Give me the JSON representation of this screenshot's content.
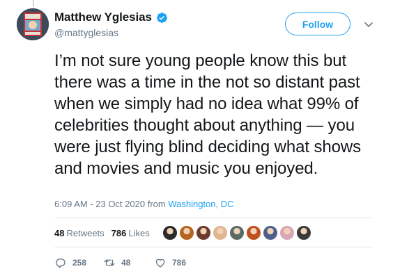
{
  "user": {
    "display_name": "Matthew Yglesias",
    "handle": "@mattyglesias",
    "verified": true,
    "avatar_icon": "profile-photo"
  },
  "follow_label": "Follow",
  "tweet": {
    "text": "I’m not sure young people know this but there was a time in the not so distant past when we simply had no idea what 99% of celebrities thought about anything — you were just flying blind deciding what shows and movies and music you enjoyed.",
    "time": "6:09 AM - 23 Oct 2020",
    "from_label": "from",
    "location": "Washington, DC"
  },
  "stats": {
    "retweets_count": "48",
    "retweets_label": "Retweets",
    "likes_count": "786",
    "likes_label": "Likes"
  },
  "likers": [
    {
      "icon": "liker-avatar",
      "color": "#2b2b2b"
    },
    {
      "icon": "liker-avatar",
      "color": "#b5651d"
    },
    {
      "icon": "liker-avatar",
      "color": "#6b3a2a"
    },
    {
      "icon": "liker-avatar",
      "color": "#e0b48f"
    },
    {
      "icon": "liker-avatar",
      "color": "#5a6b66"
    },
    {
      "icon": "liker-avatar",
      "color": "#c0501e"
    },
    {
      "icon": "liker-avatar",
      "color": "#4f5f8a"
    },
    {
      "icon": "liker-avatar",
      "color": "#d9a6b8"
    },
    {
      "icon": "liker-avatar",
      "color": "#3a3a3a"
    }
  ],
  "actions": {
    "reply_count": "258",
    "retweet_count": "48",
    "like_count": "786"
  },
  "colors": {
    "accent": "#1da1f2",
    "secondary_text": "#657786"
  }
}
